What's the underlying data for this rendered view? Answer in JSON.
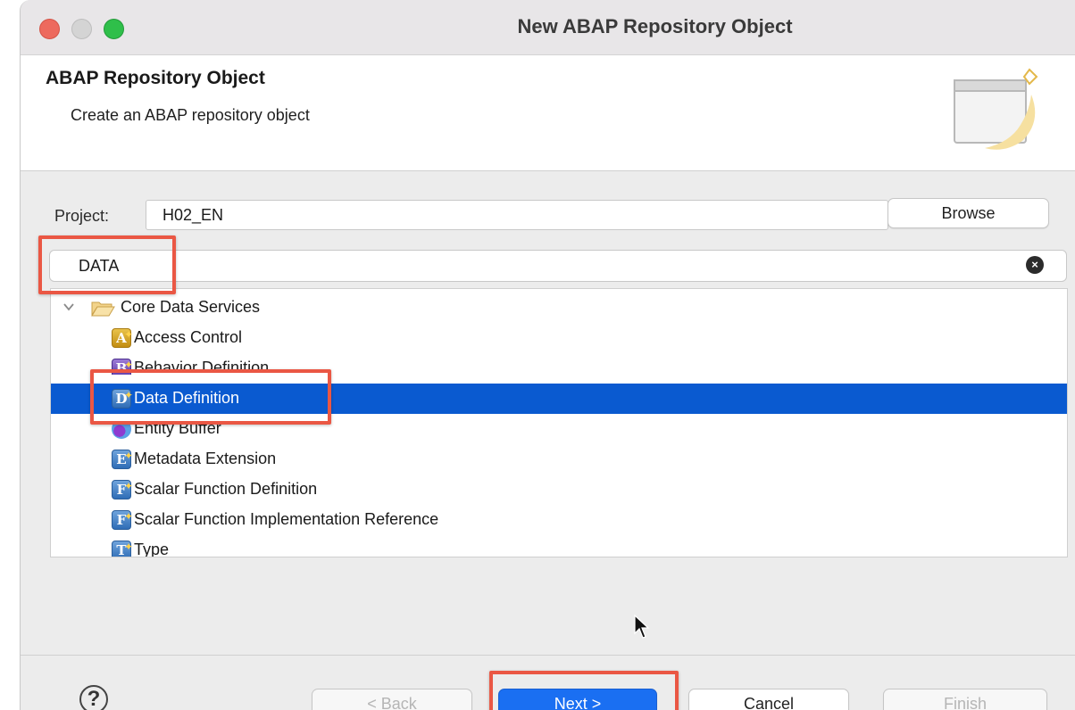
{
  "window": {
    "title": "New ABAP Repository Object"
  },
  "header": {
    "title": "ABAP Repository Object",
    "description": "Create an ABAP repository object"
  },
  "project": {
    "label": "Project:",
    "value": "H02_EN",
    "browse_label": "Browse"
  },
  "filter": {
    "value": "DATA"
  },
  "tree": {
    "folder": {
      "label": "Core Data Services",
      "icon": "folder-open-icon",
      "expanded": true
    },
    "items": [
      {
        "label": "Access Control",
        "icon": "access-control-icon",
        "glyph": "A"
      },
      {
        "label": "Behavior Definition",
        "icon": "behavior-definition-icon",
        "glyph": "B"
      },
      {
        "label": "Data Definition",
        "icon": "data-definition-icon",
        "glyph": "D",
        "selected": true
      },
      {
        "label": "Entity Buffer",
        "icon": "entity-buffer-icon",
        "glyph": ""
      },
      {
        "label": "Metadata Extension",
        "icon": "metadata-extension-icon",
        "glyph": "E"
      },
      {
        "label": "Scalar Function Definition",
        "icon": "scalar-function-definition-icon",
        "glyph": "F"
      },
      {
        "label": "Scalar Function Implementation Reference",
        "icon": "scalar-function-impl-icon",
        "glyph": "F"
      },
      {
        "label": "Type",
        "icon": "type-icon",
        "glyph": "T"
      }
    ]
  },
  "footer": {
    "help": "?",
    "back_label": "< Back",
    "next_label": "Next >",
    "cancel_label": "Cancel",
    "finish_label": "Finish"
  },
  "colors": {
    "selection": "#0a5ad0",
    "highlight": "#ea5744",
    "primary_button": "#1a6ff2"
  }
}
